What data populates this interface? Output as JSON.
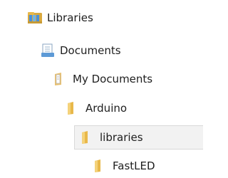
{
  "tree": {
    "items": [
      {
        "label": "Libraries",
        "icon": "libraries-icon"
      },
      {
        "label": "Documents",
        "icon": "documents-library-icon"
      },
      {
        "label": "My Documents",
        "icon": "my-documents-folder-icon"
      },
      {
        "label": "Arduino",
        "icon": "folder-icon"
      },
      {
        "label": "libraries",
        "icon": "folder-icon",
        "selected": true
      },
      {
        "label": "FastLED",
        "icon": "folder-icon"
      }
    ]
  },
  "colors": {
    "selection_bg": "#f2f2f2",
    "selection_border": "#d9d9d9",
    "folder_yellow": "#e8b84a",
    "text": "#1e1e1e"
  }
}
